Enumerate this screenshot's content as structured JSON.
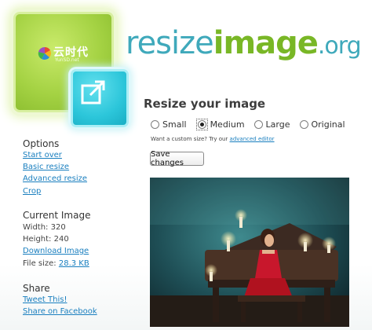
{
  "logo": {
    "partner_name": "云时代",
    "partner_sub": "YunSD.net",
    "brand_part1": "resize",
    "brand_part2": "image",
    "brand_part3": ".org"
  },
  "main": {
    "title": "Resize your image",
    "size_options": [
      {
        "label": "Small",
        "checked": false
      },
      {
        "label": "Medium",
        "checked": true
      },
      {
        "label": "Large",
        "checked": false
      },
      {
        "label": "Original",
        "checked": false
      }
    ],
    "custom_prompt": "Want a custom size? Try our",
    "custom_link": "advanced editor",
    "save_label": "Save changes"
  },
  "sidebar": {
    "options_heading": "Options",
    "options_links": [
      "Start over",
      "Basic resize",
      "Advanced resize",
      "Crop"
    ],
    "current_heading": "Current Image",
    "width_text": "Width: 320",
    "height_text": "Height: 240",
    "download_link": "Download Image",
    "file_size_label": "File size:",
    "file_size_value": "28.3 KB",
    "share_heading": "Share",
    "share_links": [
      "Tweet This!",
      "Share on Facebook"
    ]
  },
  "colors": {
    "link": "#1a7fbf",
    "brand_blue": "#3fa9bb",
    "brand_green": "#79b726"
  }
}
